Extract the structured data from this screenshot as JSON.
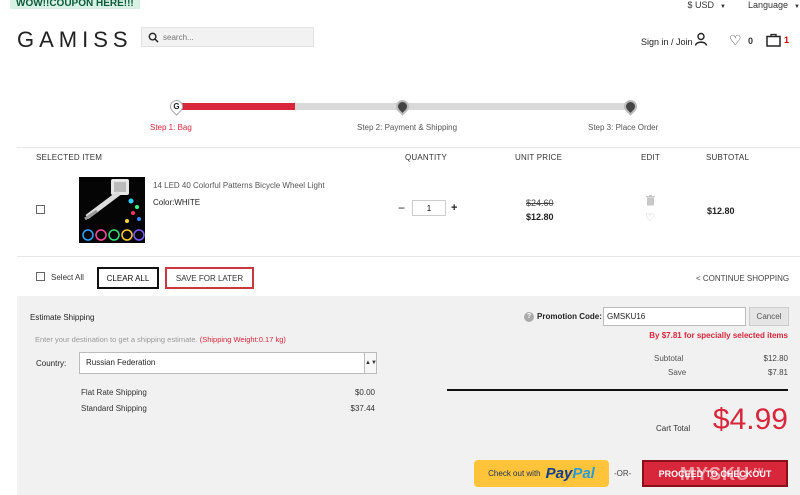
{
  "topbar": {
    "promo": "WOW!!COUPON HERE!!!",
    "currency": "$ USD",
    "language": "Language"
  },
  "header": {
    "logo": "GAMISS",
    "search_placeholder": "search...",
    "signin": "Sign in / Join",
    "wishlist_count": "0",
    "bag_count": "1"
  },
  "steps": {
    "logo_letter": "G",
    "items": [
      "Step 1: Bag",
      "Step 2: Payment & Shipping",
      "Step 3: Place Order"
    ],
    "progress_fraction": 0.26
  },
  "table": {
    "headers": [
      "SELECTED ITEM",
      "QUANTITY",
      "UNIT PRICE",
      "EDIT",
      "SUBTOTAL"
    ]
  },
  "item": {
    "name": "14 LED 40 Colorful Patterns Bicycle Wheel Light",
    "color": "Color:WHITE",
    "qty": "1",
    "old_price": "$24.60",
    "price": "$12.80",
    "subtotal": "$12.80"
  },
  "actions": {
    "select_all": "Select All",
    "clear_all": "CLEAR ALL",
    "save_for_later": "SAVE FOR LATER",
    "continue": "< CONTINUE SHOPPING"
  },
  "shipping": {
    "title": "Estimate Shipping",
    "desc": "Enter your destination to get a shipping estimate.",
    "weight": "(Shipping Weight:0.17 kg)",
    "country_label": "Country:",
    "country": "Russian Federation",
    "options": [
      {
        "name": "Flat Rate Shipping",
        "price": "$0.00"
      },
      {
        "name": "Standard Shipping",
        "price": "$37.44"
      }
    ]
  },
  "promotion": {
    "label": "Promotion Code:",
    "code": "GMSKU16",
    "cancel": "Cancel",
    "note": "By $7.81 for specially selected items"
  },
  "summary": {
    "subtotal_label": "Subtotal",
    "subtotal": "$12.80",
    "save_label": "Save",
    "save": "$7.81",
    "cart_total_label": "Cart Total",
    "cart_total": "$4.99"
  },
  "checkout": {
    "paypal_text": "Check out with",
    "paypal_brand_a": "Pay",
    "paypal_brand_b": "Pal",
    "or": "-OR-",
    "proceed": "PROCEED TO CHECKOUT",
    "watermark": "MYSKU",
    "watermark_tld": ".ru"
  },
  "colors": {
    "accent": "#d8263a",
    "paypal": "#ffc43a"
  }
}
